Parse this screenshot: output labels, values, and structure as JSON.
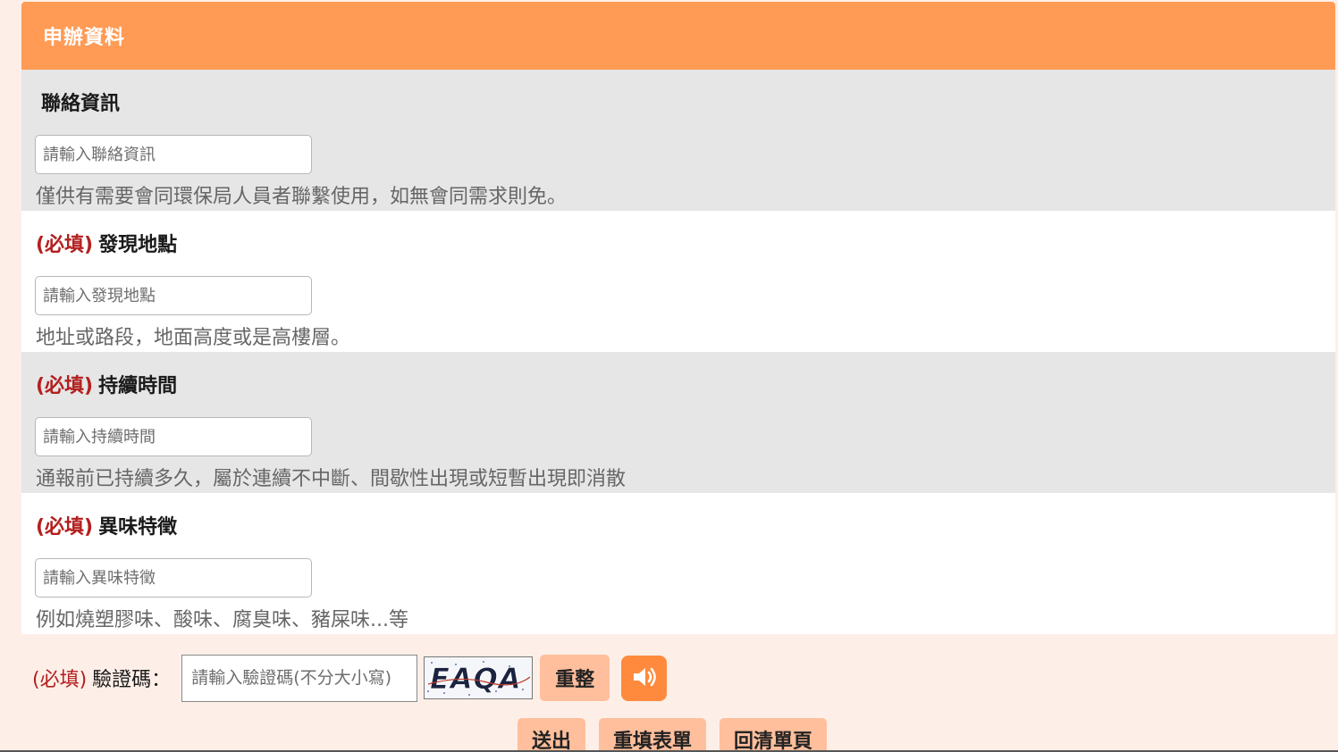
{
  "panel": {
    "title": "申辦資料"
  },
  "fields": [
    {
      "required": "",
      "label": "聯絡資訊",
      "placeholder": "請輸入聯絡資訊",
      "hint": "僅供有需要會同環保局人員者聯繫使用，如無會同需求則免。"
    },
    {
      "required": "(必填)",
      "label": "發現地點",
      "placeholder": "請輸入發現地點",
      "hint": "地址或路段，地面高度或是高樓層。"
    },
    {
      "required": "(必填)",
      "label": "持續時間",
      "placeholder": "請輸入持續時間",
      "hint": "通報前已持續多久，屬於連續不中斷、間歇性出現或短暫出現即消散"
    },
    {
      "required": "(必填)",
      "label": "異味特徵",
      "placeholder": "請輸入異味特徵",
      "hint": "例如燒塑膠味、酸味、腐臭味、豬屎味...等"
    }
  ],
  "captcha": {
    "required": "(必填)",
    "label": "驗證碼：",
    "placeholder": "請輸入驗證碼(不分大小寫)",
    "image_text": "EAQA",
    "refresh_label": "重整",
    "audio_icon": "speaker-icon"
  },
  "actions": {
    "submit_label": "送出",
    "reset_label": "重填表單",
    "back_label": "回清單頁"
  },
  "colors": {
    "header": "#ff9b55",
    "button": "#ffbf9c",
    "audio_button": "#ff8a3d",
    "required": "#b3201f"
  }
}
